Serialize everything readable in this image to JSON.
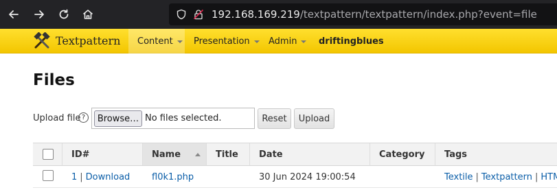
{
  "browser": {
    "url_host": "192.168.169.219",
    "url_path": "/textpattern/textpattern/index.php?event=file"
  },
  "header": {
    "brand": "Textpattern",
    "menu": [
      {
        "label": "Content"
      },
      {
        "label": "Presentation"
      },
      {
        "label": "Admin"
      }
    ],
    "user": "driftingblues"
  },
  "page": {
    "title": "Files",
    "upload_label": "Upload file",
    "help_symbol": "?",
    "browse_label": "Browse…",
    "no_file_text": "No files selected.",
    "reset_label": "Reset",
    "upload_label_btn": "Upload"
  },
  "table": {
    "columns": [
      "ID#",
      "Name",
      "Title",
      "Date",
      "Category",
      "Tags"
    ],
    "sorted_column": "Name",
    "rows": [
      {
        "id": "1",
        "download": "Download",
        "name": "fl0k1.php",
        "title": "",
        "date": "30 Jun 2024 19:00:54",
        "category": "",
        "tags": [
          "Textile",
          "Textpattern",
          "HTML"
        ]
      }
    ]
  },
  "colors": {
    "header_yellow": "#f6d000",
    "link": "#0b5ea8",
    "browser_chrome": "#232326"
  }
}
